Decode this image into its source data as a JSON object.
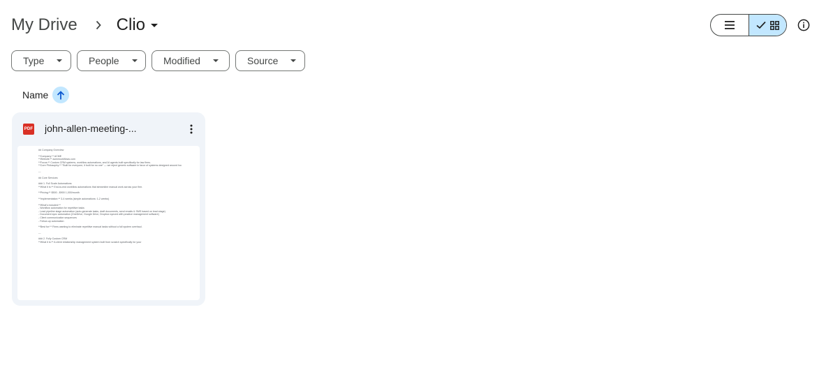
{
  "breadcrumb": {
    "root": "My Drive",
    "current": "Clio"
  },
  "filters": [
    {
      "label": "Type"
    },
    {
      "label": "People"
    },
    {
      "label": "Modified"
    },
    {
      "label": "Source"
    }
  ],
  "sort": {
    "label": "Name",
    "direction": "ascending"
  },
  "file": {
    "name": "john-allen-meeting-...",
    "type_badge": "PDF",
    "preview_lines": [
      "## Company Overview",
      "",
      "**Company:** ACME",
      "**Website:** acmeworkflows.com",
      "**Focus:** Custom CRM systems, workflow automations, and AI agents built specifically for law firms.",
      "**Core Philosophy:** \"Built for everyone, it built for no one\" — we reject generic software in favor of systems designed around how your firm actually operates.",
      "",
      "---",
      "",
      "## Core Services",
      "",
      "### 1. Full Scale Automations",
      "**What it is:** End-to-end workflow automations that streamline manual work across your firm.",
      "",
      "**Pricing:** $500 - $900 1,000/month",
      "",
      "**Implementation:** 3-4 weeks (simple automations: 1-2 weeks)",
      "",
      "**What's included:**",
      "- Workflow automation for repetitive tasks",
      "- Lead pipeline stage automation (auto-generate tasks, draft documents, send emails & SMS based on lead stage)",
      "- Document sync automation (OneDrive, Google Drive, Dropbox synced with practice management software)",
      "- Client communication sequences",
      "- Follow-up automation",
      "",
      "**Best for:** Firms wanting to eliminate repetitive manual tasks without a full system overhaul.",
      "",
      "---",
      "",
      "### 2. Fully Custom CRM",
      "**What it is:** A client relationship management system built from scratch specifically for your"
    ]
  },
  "icons": {
    "breadcrumb_sep": "chevron-right-icon",
    "list_view": "list-view-icon",
    "grid_view": "grid-view-icon",
    "checkmark": "check-icon",
    "info": "info-icon",
    "more": "more-vert-icon",
    "sort": "arrow-up-icon"
  },
  "colors": {
    "active_toggle": "#c2e7ff",
    "card_bg": "#f0f4f9",
    "pdf_red": "#d93025"
  }
}
